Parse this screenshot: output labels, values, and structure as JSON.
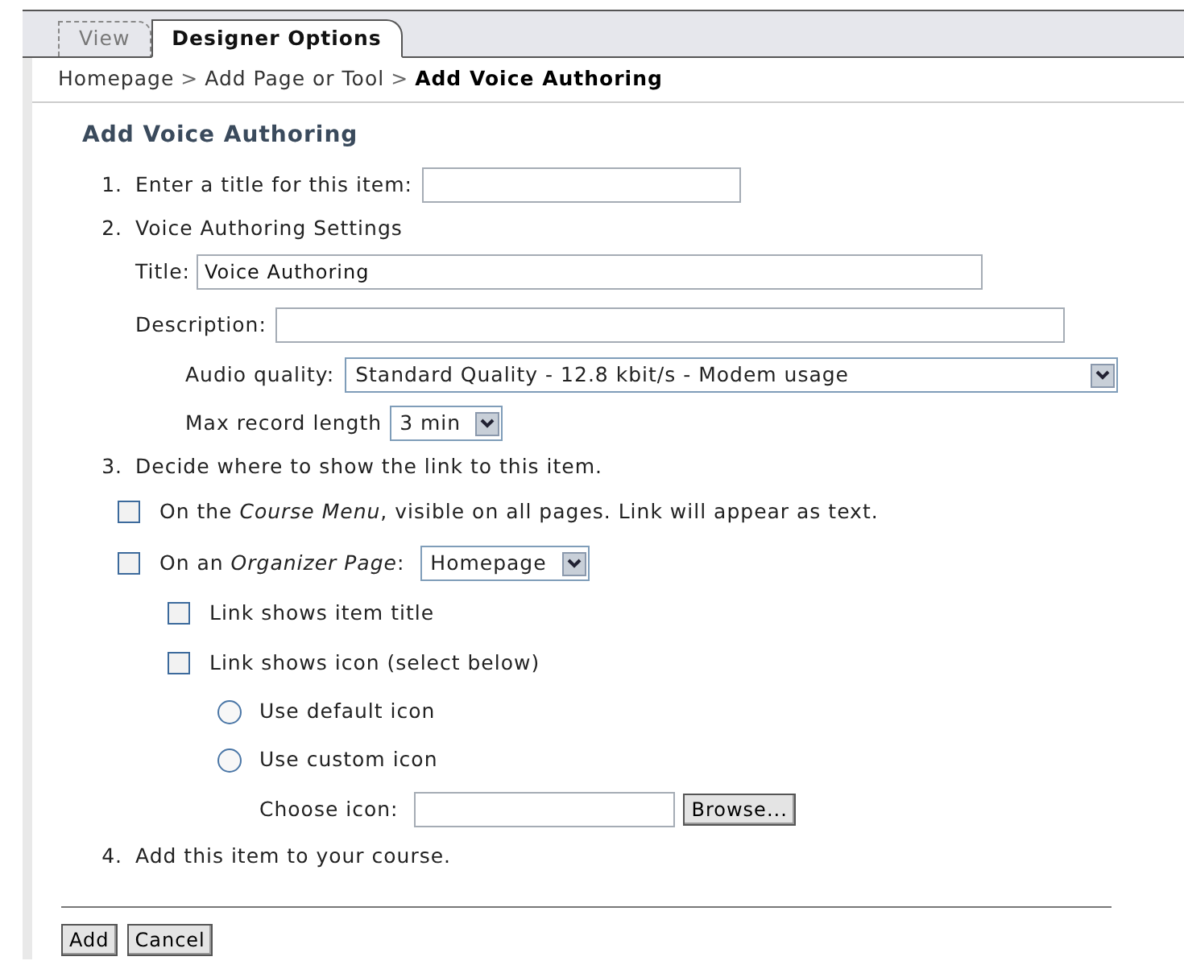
{
  "tabs": [
    {
      "label": "View",
      "selected": false
    },
    {
      "label": "Designer Options",
      "selected": true
    }
  ],
  "breadcrumb": [
    {
      "label": "Homepage",
      "current": false
    },
    {
      "label": "Add Page or Tool",
      "current": false
    },
    {
      "label": "Add Voice Authoring",
      "current": true
    }
  ],
  "breadcrumb_separator": ">",
  "heading": "Add Voice Authoring",
  "step1": {
    "number": "1.",
    "label": "Enter a title for this item:"
  },
  "step2": {
    "number": "2.",
    "label": "Voice Authoring Settings",
    "title_label": "Title:",
    "title_value": "Voice Authoring",
    "description_label": "Description:",
    "audio_label": "Audio quality:",
    "audio_value": "Standard Quality - 12.8 kbit/s - Modem usage",
    "length_label": "Max record length",
    "length_value": "3 min"
  },
  "step3": {
    "number": "3.",
    "label": "Decide where to show the link to this item.",
    "course_menu": {
      "label": "On the *Course Menu*, visible on all pages. Link will appear as text.",
      "checked": false
    },
    "organizer": {
      "label": "On an *Organizer Page*:",
      "checked": false,
      "page_value": "Homepage"
    },
    "link_options": [
      {
        "label": "Link shows item title",
        "checked": false
      },
      {
        "label": "Link shows icon (select below)",
        "checked": false
      }
    ],
    "icon_options": [
      {
        "label": "Use default icon",
        "selected": false
      },
      {
        "label": "Use custom icon",
        "selected": false
      }
    ],
    "choose_label": "Choose icon:",
    "browse": "Browse..."
  },
  "step4": {
    "number": "4.",
    "label": "Add this item to your course."
  },
  "buttons": [
    "Add",
    "Cancel"
  ]
}
